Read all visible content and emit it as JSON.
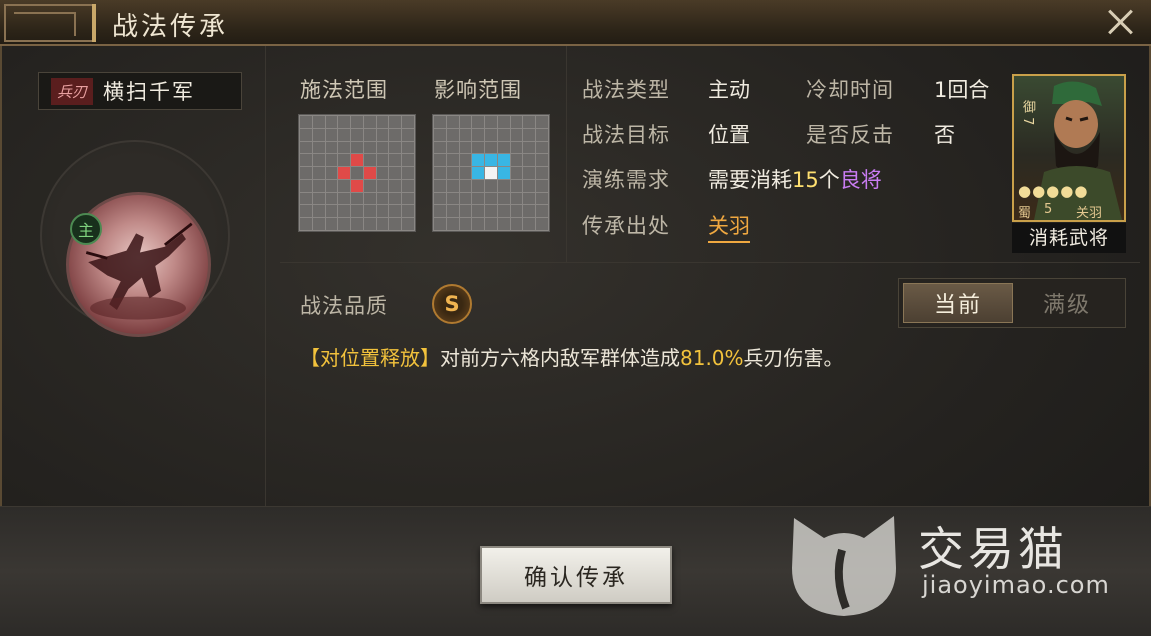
{
  "window": {
    "title": "战法传承",
    "close_icon": "close-icon"
  },
  "skill": {
    "type_tag": "兵刃",
    "name": "横扫千军",
    "main_badge": "主"
  },
  "range": {
    "cast_label": "施法范围",
    "effect_label": "影响范围"
  },
  "info": {
    "type_label": "战法类型",
    "type_value": "主动",
    "cooldown_label": "冷却时间",
    "cooldown_value": "1回合",
    "target_label": "战法目标",
    "target_value": "位置",
    "counter_label": "是否反击",
    "counter_value": "否",
    "requirement_label": "演练需求",
    "requirement_prefix": "需要消耗",
    "requirement_count": "15",
    "requirement_unit": "个",
    "requirement_tier": "良将",
    "origin_label": "传承出处",
    "origin_value": "关羽"
  },
  "hero_card": {
    "side_text": "御 7",
    "stars": "●●●●●",
    "kingdom": "蜀",
    "cost": "5",
    "name": "关羽",
    "caption": "消耗武将"
  },
  "quality": {
    "label": "战法品质",
    "grade": "S"
  },
  "toggle": {
    "current": "当前",
    "max": "满级"
  },
  "description": {
    "tag": "【对位置释放】",
    "before": "对前方六格内敌军群体造成",
    "percent": "81.0%",
    "after": "兵刃伤害。"
  },
  "confirm_button": "确认传承",
  "watermark": {
    "brand": "交易猫",
    "url": "jiaoyimao.com"
  },
  "colors": {
    "accent_gold": "#f2c23c",
    "link_orange": "#f0a840",
    "tier_purple": "#c97cf2",
    "grade_s": "#f0b450"
  }
}
